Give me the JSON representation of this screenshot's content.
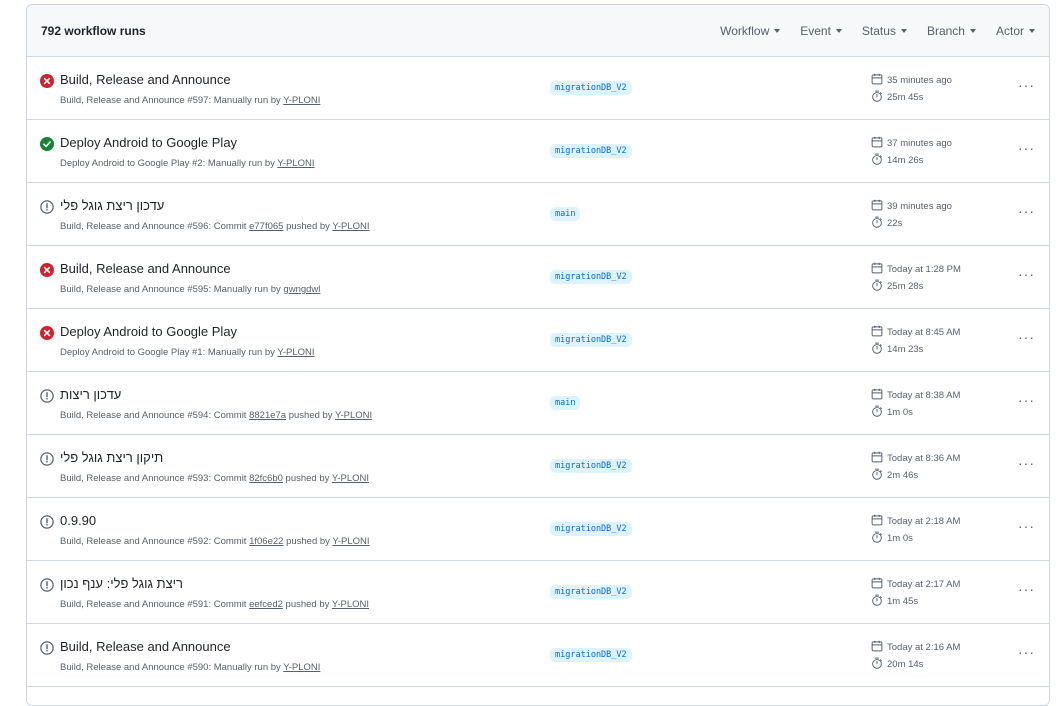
{
  "header": {
    "count_label": "792 workflow runs",
    "filters": [
      "Workflow",
      "Event",
      "Status",
      "Branch",
      "Actor"
    ]
  },
  "colors": {
    "failure": "#cf222e",
    "success": "#1a7f37",
    "neutral": "#57606a",
    "branch_bg": "#ddf4ff",
    "branch_fg": "#0969da"
  },
  "runs": [
    {
      "status": "failure",
      "title": "Build, Release and Announce",
      "workflow": "Build, Release and Announce #597",
      "trigger": "Manually run by",
      "commit": "",
      "actor": "Y-PLONI",
      "branch": "migrationDB_V2",
      "time": "35 minutes ago",
      "duration": "25m 45s"
    },
    {
      "status": "success",
      "title": "Deploy Android to Google Play",
      "workflow": "Deploy Android to Google Play #2",
      "trigger": "Manually run by",
      "commit": "",
      "actor": "Y-PLONI",
      "branch": "migrationDB_V2",
      "time": "37 minutes ago",
      "duration": "14m 26s"
    },
    {
      "status": "neutral",
      "title": "עדכון ריצת גוגל פלי",
      "workflow": "Build, Release and Announce #596",
      "trigger": "Commit",
      "commit": "e77f065",
      "actor": "Y-PLONI",
      "branch": "main",
      "time": "39 minutes ago",
      "duration": "22s"
    },
    {
      "status": "failure",
      "title": "Build, Release and Announce",
      "workflow": "Build, Release and Announce #595",
      "trigger": "Manually run by",
      "commit": "",
      "actor": "gwngdwl",
      "branch": "migrationDB_V2",
      "time": "Today at 1:28 PM",
      "duration": "25m 28s"
    },
    {
      "status": "failure",
      "title": "Deploy Android to Google Play",
      "workflow": "Deploy Android to Google Play #1",
      "trigger": "Manually run by",
      "commit": "",
      "actor": "Y-PLONI",
      "branch": "migrationDB_V2",
      "time": "Today at 8:45 AM",
      "duration": "14m 23s"
    },
    {
      "status": "neutral",
      "title": "עדכון ריצות",
      "workflow": "Build, Release and Announce #594",
      "trigger": "Commit",
      "commit": "8821e7a",
      "actor": "Y-PLONI",
      "branch": "main",
      "time": "Today at 8:38 AM",
      "duration": "1m 0s"
    },
    {
      "status": "neutral",
      "title": "תיקון ריצת גוגל פלי",
      "workflow": "Build, Release and Announce #593",
      "trigger": "Commit",
      "commit": "82fc6b0",
      "actor": "Y-PLONI",
      "branch": "migrationDB_V2",
      "time": "Today at 8:36 AM",
      "duration": "2m 46s"
    },
    {
      "status": "neutral",
      "title": "0.9.90",
      "workflow": "Build, Release and Announce #592",
      "trigger": "Commit",
      "commit": "1f06e22",
      "actor": "Y-PLONI",
      "branch": "migrationDB_V2",
      "time": "Today at 2:18 AM",
      "duration": "1m 0s"
    },
    {
      "status": "neutral",
      "title": "ריצת גוגל פלי: ענף נכון",
      "workflow": "Build, Release and Announce #591",
      "trigger": "Commit",
      "commit": "eefced2",
      "actor": "Y-PLONI",
      "branch": "migrationDB_V2",
      "time": "Today at 2:17 AM",
      "duration": "1m 45s"
    },
    {
      "status": "neutral",
      "title": "Build, Release and Announce",
      "workflow": "Build, Release and Announce #590",
      "trigger": "Manually run by",
      "commit": "",
      "actor": "Y-PLONI",
      "branch": "migrationDB_V2",
      "time": "Today at 2:16 AM",
      "duration": "20m 14s"
    }
  ]
}
